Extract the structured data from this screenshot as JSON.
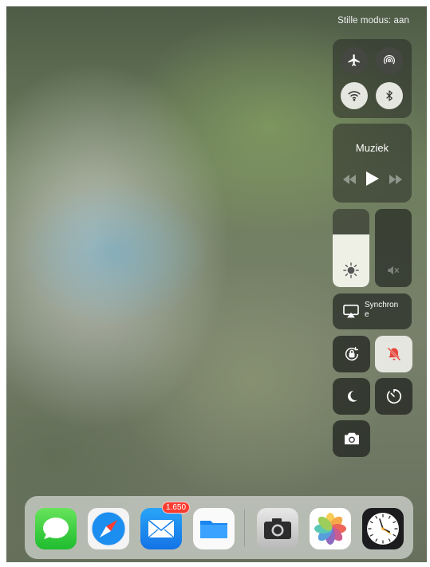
{
  "status_bar": {
    "silent_mode_text": "Stille modus: aan"
  },
  "connectivity": {
    "airplane": {
      "icon": "airplane-icon",
      "state": "off"
    },
    "airdrop": {
      "icon": "airdrop-icon",
      "state": "off"
    },
    "wifi": {
      "icon": "wifi-icon",
      "state": "on"
    },
    "bluetooth": {
      "icon": "bluetooth-icon",
      "state": "on"
    }
  },
  "music": {
    "title": "Muziek",
    "rewind_icon": "rewind-icon",
    "play_icon": "play-icon",
    "forward_icon": "fast-forward-icon"
  },
  "brightness": {
    "icon": "sun-icon",
    "level": 0.67
  },
  "volume": {
    "icon": "speaker-muted-icon",
    "level": 0.0
  },
  "airplay": {
    "label": "Synchron e",
    "icon": "airplay-icon"
  },
  "toggles": {
    "rotation_lock": {
      "icon": "rotation-lock-icon",
      "state": "off"
    },
    "silent": {
      "icon": "bell-muted-icon",
      "state": "on",
      "color": "#e8453c"
    },
    "do_not_disturb": {
      "icon": "moon-icon",
      "state": "off"
    },
    "timer": {
      "icon": "timer-icon",
      "state": "off"
    },
    "camera": {
      "icon": "camera-icon"
    }
  },
  "dock": {
    "apps": [
      {
        "name": "Messages",
        "icon": "messages-icon"
      },
      {
        "name": "Safari",
        "icon": "safari-icon"
      },
      {
        "name": "Mail",
        "icon": "mail-icon",
        "badge": "1.650"
      },
      {
        "name": "Files",
        "icon": "files-icon"
      },
      {
        "name": "Camera",
        "icon": "camera-app-icon"
      },
      {
        "name": "Photos",
        "icon": "photos-icon"
      },
      {
        "name": "Clock",
        "icon": "clock-icon"
      }
    ]
  }
}
